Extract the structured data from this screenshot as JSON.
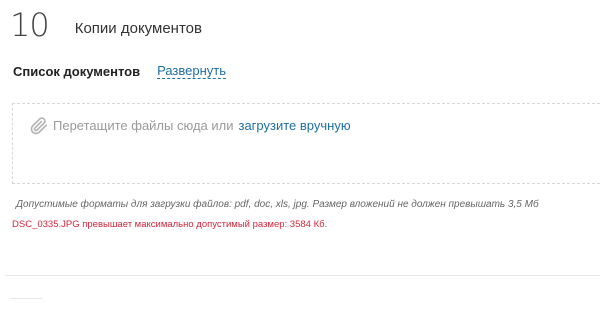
{
  "section": {
    "number": "10",
    "title": "Копии документов"
  },
  "documents": {
    "label": "Список документов",
    "expand_link": "Развернуть"
  },
  "dropzone": {
    "icon": "paperclip-icon",
    "prompt": "Перетащите файлы сюда или",
    "upload_link": "загрузите вручную"
  },
  "hint": {
    "formats": "Допустимые форматы для загрузки файлов: pdf, doc, xls, jpg. Размер вложений не должен превышать 3,5 Мб"
  },
  "error": {
    "message": "DSC_0335.JPG превышает максимально допустимый размер: 3584 Кб."
  },
  "colors": {
    "link": "#1f6fa3",
    "error": "#d0263c",
    "muted_text": "#9a9a9a",
    "border": "#d7d7d7"
  }
}
